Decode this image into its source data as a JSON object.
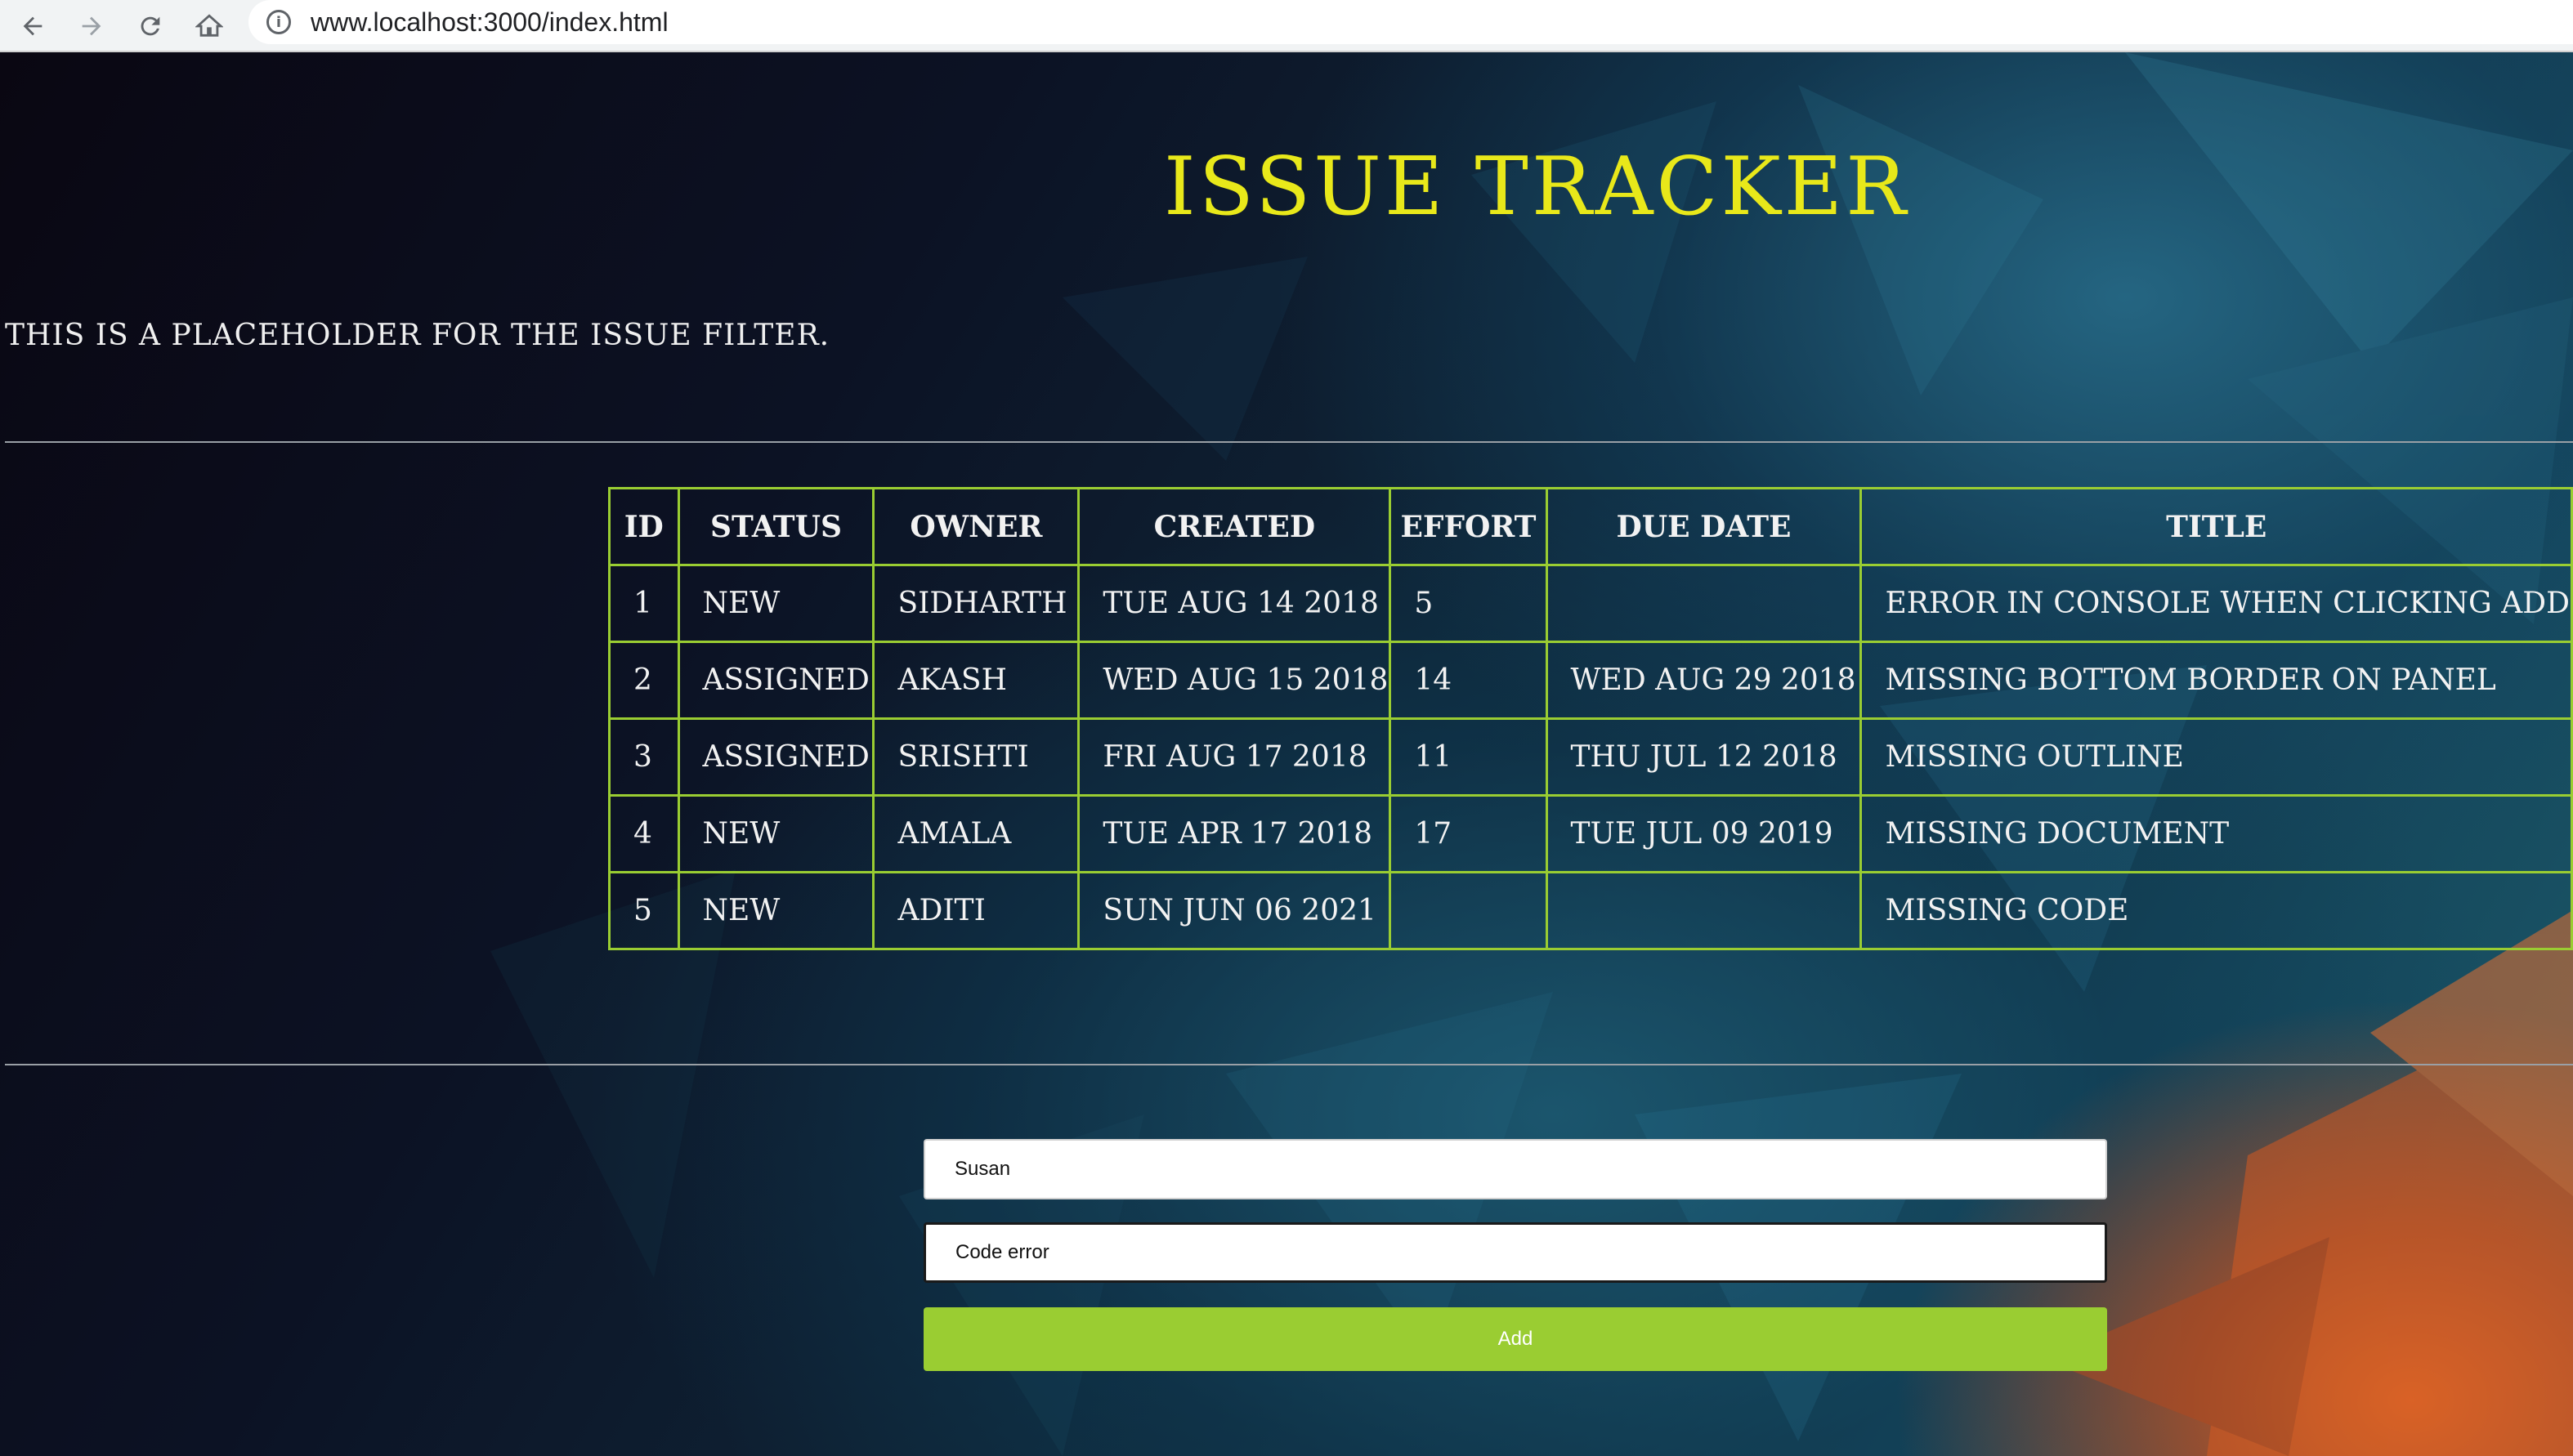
{
  "browser": {
    "url": "www.localhost:3000/index.html",
    "back_icon": "arrow-left-icon",
    "forward_icon": "arrow-right-icon",
    "reload_icon": "reload-icon",
    "home_icon": "home-icon",
    "info_icon": "info-icon"
  },
  "page": {
    "title": "ISSUE TRACKER",
    "filter_placeholder": "THIS IS A PLACEHOLDER FOR THE ISSUE FILTER."
  },
  "table": {
    "headers": [
      "ID",
      "STATUS",
      "OWNER",
      "CREATED",
      "EFFORT",
      "DUE DATE",
      "TITLE"
    ],
    "rows": [
      {
        "id": "1",
        "status": "NEW",
        "owner": "SIDHARTH",
        "created": "TUE AUG 14 2018",
        "effort": "5",
        "due": "",
        "title": "ERROR IN CONSOLE WHEN CLICKING ADD"
      },
      {
        "id": "2",
        "status": "ASSIGNED",
        "owner": "AKASH",
        "created": "WED AUG 15 2018",
        "effort": "14",
        "due": "WED AUG 29 2018",
        "title": "MISSING BOTTOM BORDER ON PANEL"
      },
      {
        "id": "3",
        "status": "ASSIGNED",
        "owner": "SRISHTI",
        "created": "FRI AUG 17 2018",
        "effort": "11",
        "due": "THU JUL 12 2018",
        "title": "MISSING OUTLINE"
      },
      {
        "id": "4",
        "status": "NEW",
        "owner": "AMALA",
        "created": "TUE APR 17 2018",
        "effort": "17",
        "due": "TUE JUL 09 2019",
        "title": "MISSING DOCUMENT"
      },
      {
        "id": "5",
        "status": "NEW",
        "owner": "ADITI",
        "created": "SUN JUN 06 2021",
        "effort": "",
        "due": "",
        "title": "MISSING CODE"
      }
    ]
  },
  "form": {
    "owner_value": "Susan",
    "title_value": "Code error",
    "add_label": "Add"
  },
  "colors": {
    "title": "#e8e81a",
    "table_border": "#9acd32",
    "button": "#9acd32"
  }
}
